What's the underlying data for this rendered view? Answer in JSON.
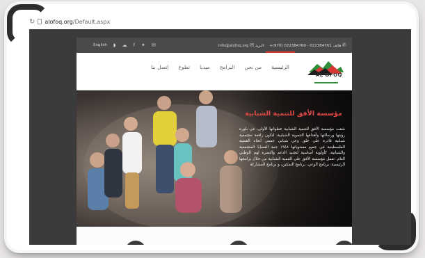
{
  "browser": {
    "url_host": "alofoq.org",
    "url_path": "/Default.aspx"
  },
  "topbar": {
    "language_link": "English",
    "email_label": "البريد",
    "email": "info@alofoq.org",
    "phone_label": "هاتف",
    "phones": "+(970) 022384760 - 022384761"
  },
  "logo": {
    "text": "AL'OFOQ"
  },
  "nav": {
    "items": [
      {
        "label": "الرئيسية",
        "active": true
      },
      {
        "label": "من نحن",
        "active": false
      },
      {
        "label": "البرامج",
        "active": false
      },
      {
        "label": "ميديا",
        "active": false
      },
      {
        "label": "تطوع",
        "active": false
      },
      {
        "label": "إتصل بنا",
        "active": false
      }
    ]
  },
  "hero": {
    "title": "مؤسسة الأفق للتنمية الشبابية",
    "text": "شقت مؤسسة الأفق للتنمية الشبابية خطواتها الأولى، في بلورة رؤيتها ورسالتها وأهدافها التنموية الشبابية، لتكون رافعة مجتمعية شبابية قادرة على خلق وعي شبابي جمعي اتجاه القضية الفلسطينية في جميع مستوياتها ١٩٤٨ جعة القضايا المجتمعية والشبابية، كأولوية أساسية لتجنيد الدعم والنصرة لهم الوطني العام. تعمل مؤسسة الأفق على التنمية الشبابية من خلال برامجها الرئيسية: برنامج الوعي، برنامج التمكين، و برنامج المشاركة"
  },
  "colors": {
    "accent": "#d8382e",
    "topbar_bg": "#4a4a4a",
    "browser_bg": "#3b3b3b"
  }
}
